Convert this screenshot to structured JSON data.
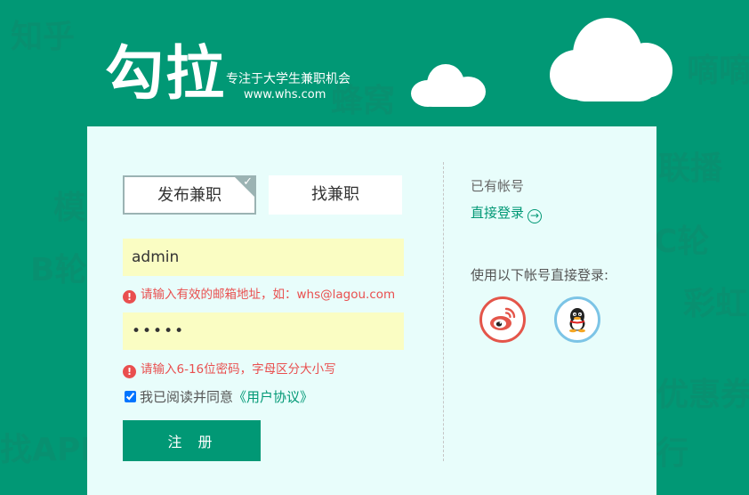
{
  "background_words": [
    "知乎",
    "嘀嘀",
    "蜂窝",
    "联播",
    "模",
    "C轮",
    "B轮",
    "彩虹",
    "优惠券",
    "找API",
    "行"
  ],
  "brand": {
    "logo": "勾拉",
    "slogan": "专注于大学生兼职机会",
    "url": "www.whs.com"
  },
  "role_tabs": [
    {
      "label": "发布兼职",
      "selected": true
    },
    {
      "label": "找兼职",
      "selected": false
    }
  ],
  "form": {
    "email_value": "admin",
    "email_error": "请输入有效的邮箱地址，如：whs@lagou.com",
    "password_value": "admin",
    "password_error": "请输入6-16位密码，字母区分大小写",
    "agree_text": "我已阅读并同意",
    "agreement_link": "《用户协议》",
    "agree_checked": true,
    "submit_label": "注册"
  },
  "sidebar": {
    "has_account": "已有帐号",
    "direct_login": "直接登录",
    "social_title": "使用以下帐号直接登录:",
    "social": [
      {
        "name": "weibo",
        "icon": "weibo-icon",
        "color": "#e4554a"
      },
      {
        "name": "qq",
        "icon": "qq-icon",
        "color": "#7cc4e6"
      }
    ]
  },
  "colors": {
    "brand_green": "#019875",
    "panel_bg": "#e8fdfb",
    "input_bg": "#fafdc3",
    "error_red": "#e94f4f"
  }
}
